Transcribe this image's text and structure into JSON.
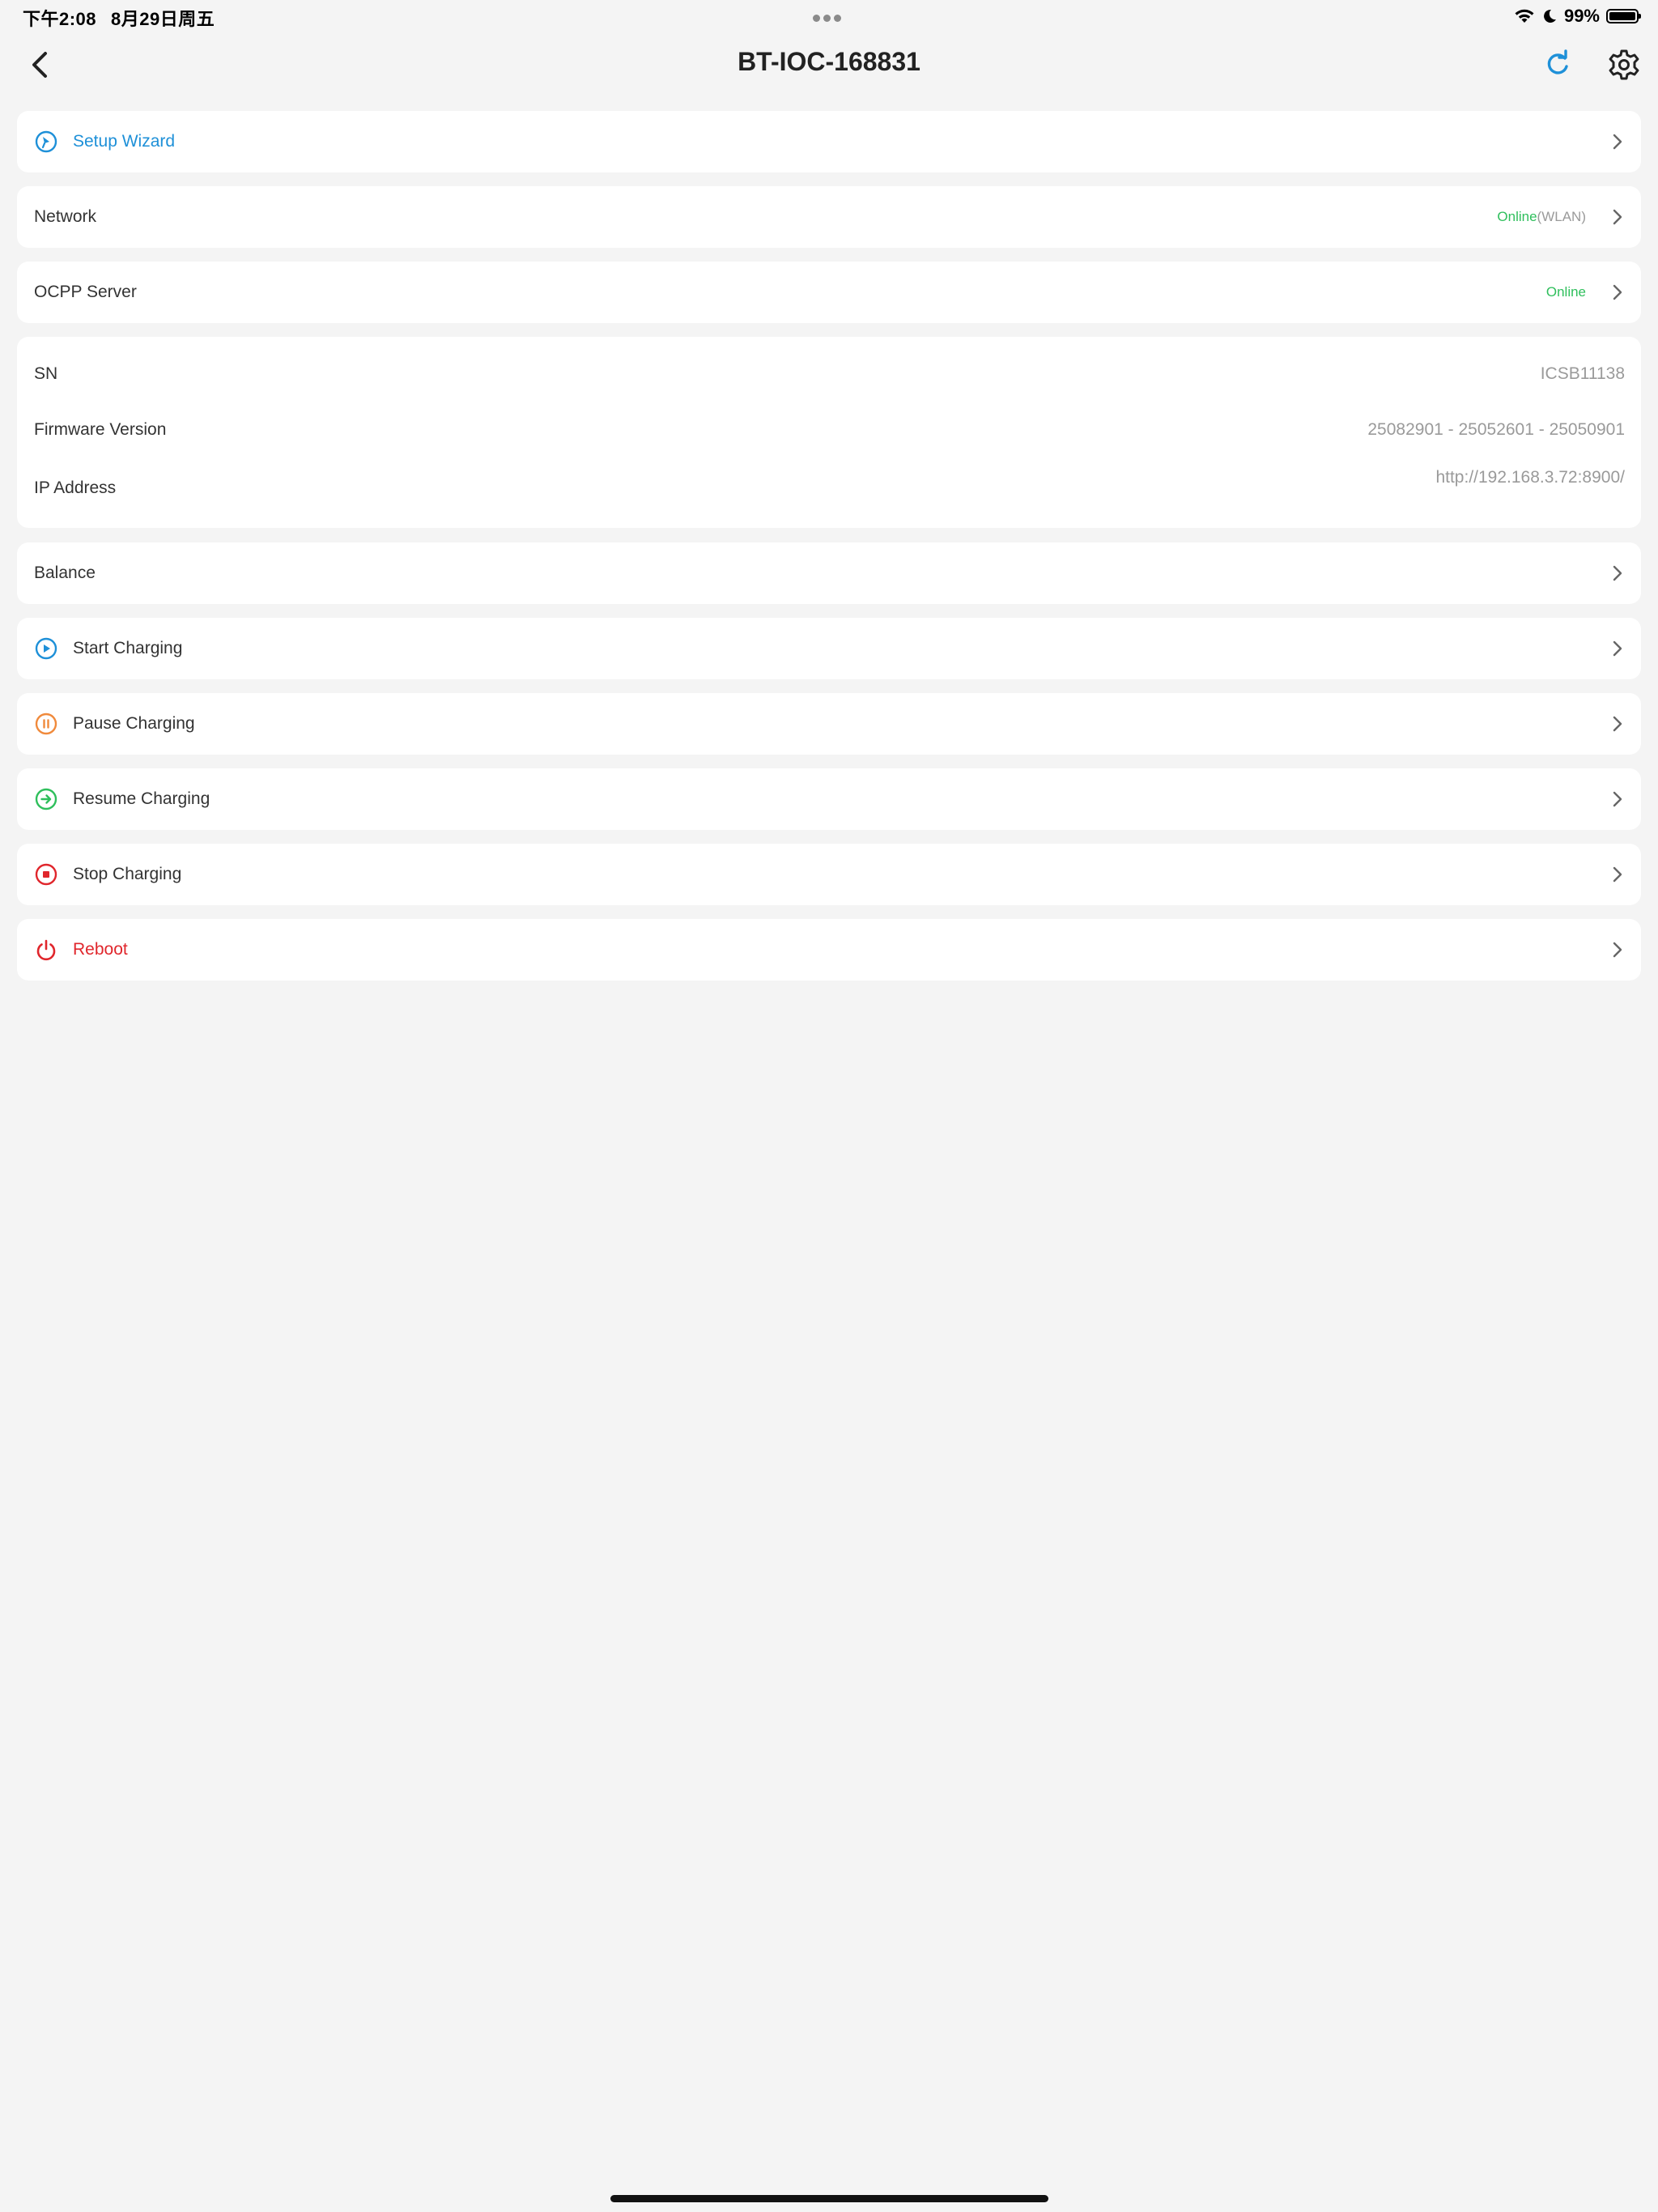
{
  "status_bar": {
    "time": "下午2:08",
    "date": "8月29日周五",
    "battery": "99%",
    "battery_level": 0.99
  },
  "nav": {
    "title": "BT-IOC-168831"
  },
  "menu": {
    "setup_wizard": "Setup Wizard",
    "network": {
      "label": "Network",
      "status": "Online",
      "detail": "(WLAN)"
    },
    "ocpp": {
      "label": "OCPP Server",
      "status": "Online"
    },
    "info": {
      "sn_label": "SN",
      "sn_value": "ICSB11138",
      "fw_label": "Firmware Version",
      "fw_value": "25082901 - 25052601 - 25050901",
      "ip_label": "IP Address",
      "ip_value": "http://192.168.3.72:8900/"
    },
    "balance": "Balance",
    "start": "Start Charging",
    "pause": "Pause Charging",
    "resume": "Resume Charging",
    "stop": "Stop Charging",
    "reboot": "Reboot"
  },
  "colors": {
    "accent_blue": "#1e90d8",
    "online_green": "#2fbf5c",
    "pause_orange": "#f08a3c",
    "resume_green": "#2fbf5c",
    "danger_red": "#e0262c",
    "background": "#f4f4f4"
  }
}
